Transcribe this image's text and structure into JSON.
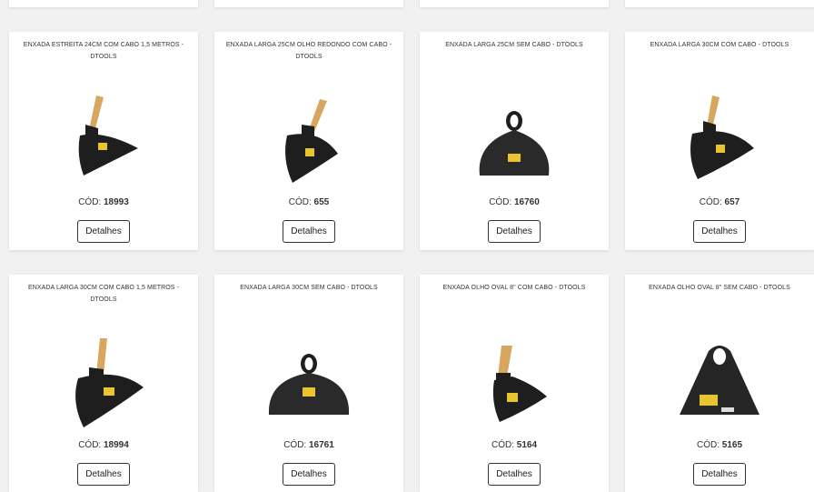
{
  "products": [
    {
      "title": "ENXADA ESTREITA 24CM COM CABO 1,5 METROS - DTOOLS",
      "code_label": "CÓD:",
      "code": "18993",
      "details_label": "Detalhes",
      "image_icon": "narrow-hoe-with-handle-icon"
    },
    {
      "title": "ENXADA LARGA 25CM OLHO REDONDO COM CABO - DTOOLS",
      "code_label": "CÓD:",
      "code": "655",
      "details_label": "Detalhes",
      "image_icon": "wide-hoe-with-handle-icon"
    },
    {
      "title": "ENXADA LARGA 25CM SEM CABO - DTOOLS",
      "code_label": "CÓD:",
      "code": "16760",
      "details_label": "Detalhes",
      "image_icon": "wide-hoe-head-icon"
    },
    {
      "title": "ENXADA LARGA 30CM COM CABO - DTOOLS",
      "code_label": "CÓD:",
      "code": "657",
      "details_label": "Detalhes",
      "image_icon": "wide-hoe-with-handle-icon"
    },
    {
      "title": "ENXADA LARGA 30CM COM CABO 1,5 METROS - DTOOLS",
      "code_label": "CÓD:",
      "code": "18994",
      "details_label": "Detalhes",
      "image_icon": "wide-hoe-with-handle-icon"
    },
    {
      "title": "ENXADA LARGA 30CM SEM CABO - DTOOLS",
      "code_label": "CÓD:",
      "code": "16761",
      "details_label": "Detalhes",
      "image_icon": "wide-hoe-head-icon"
    },
    {
      "title": "ENXADA OLHO OVAL 8\" COM CABO - DTOOLS",
      "code_label": "CÓD:",
      "code": "5164",
      "details_label": "Detalhes",
      "image_icon": "oval-eye-hoe-with-handle-icon"
    },
    {
      "title": "ENXADA OLHO OVAL 8\" SEM CABO - DTOOLS",
      "code_label": "CÓD:",
      "code": "5165",
      "details_label": "Detalhes",
      "image_icon": "oval-eye-hoe-head-icon"
    }
  ],
  "colors": {
    "page_background": "#f1f1f1",
    "card_background": "#ffffff",
    "text": "#333333",
    "button_border": "#333333",
    "hoe_blade": "#1e1e1e",
    "handle_wood": "#d8a65e",
    "brand_label": "#e8c430"
  }
}
